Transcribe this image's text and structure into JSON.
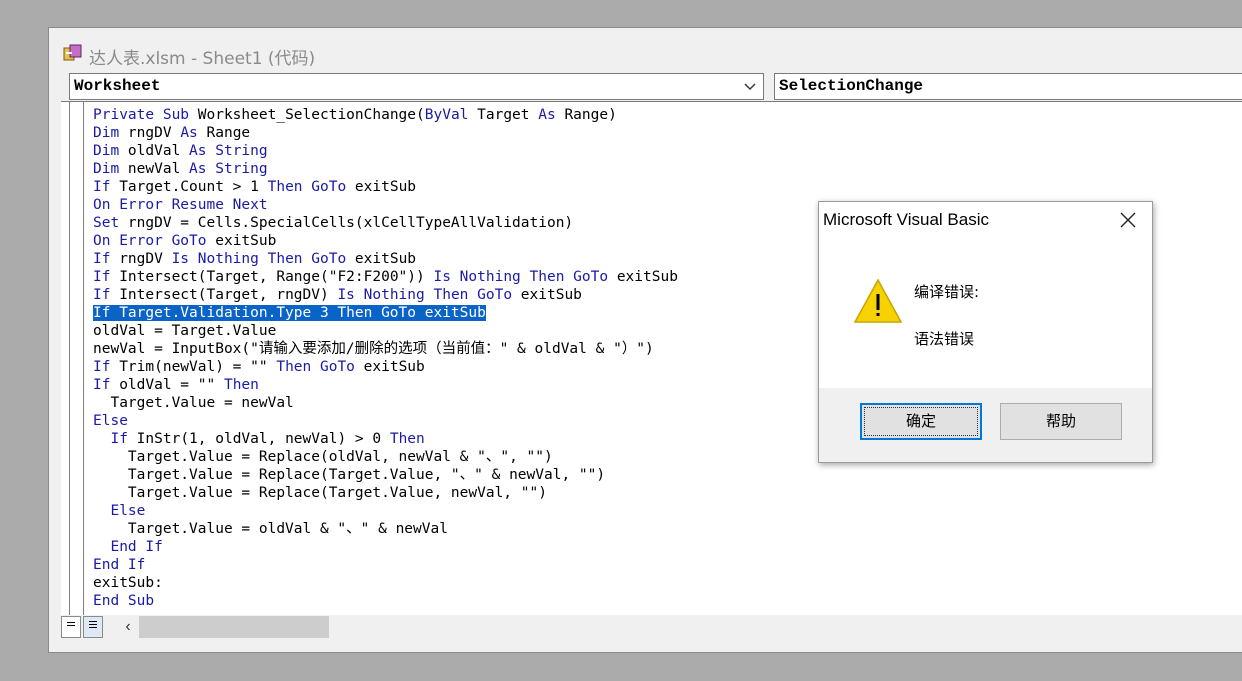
{
  "window": {
    "title": "达人表.xlsm - Sheet1 (代码)",
    "app_icon": "vba-project-icon"
  },
  "combos": {
    "object": "Worksheet",
    "procedure": "SelectionChange"
  },
  "code_lines": [
    [
      {
        "t": "Private Sub ",
        "k": true
      },
      {
        "t": "Worksheet_SelectionChange("
      },
      {
        "t": "ByVal",
        "k": true
      },
      {
        "t": " Target "
      },
      {
        "t": "As",
        "k": true
      },
      {
        "t": " Range)"
      }
    ],
    [
      {
        "t": "Dim",
        "k": true
      },
      {
        "t": " rngDV "
      },
      {
        "t": "As",
        "k": true
      },
      {
        "t": " Range"
      }
    ],
    [
      {
        "t": "Dim",
        "k": true
      },
      {
        "t": " oldVal "
      },
      {
        "t": "As String",
        "k": true
      }
    ],
    [
      {
        "t": "Dim",
        "k": true
      },
      {
        "t": " newVal "
      },
      {
        "t": "As String",
        "k": true
      }
    ],
    [
      {
        "t": "If",
        "k": true
      },
      {
        "t": " Target.Count > 1 "
      },
      {
        "t": "Then GoTo",
        "k": true
      },
      {
        "t": " exitSub"
      }
    ],
    [
      {
        "t": "On Error Resume Next",
        "k": true
      }
    ],
    [
      {
        "t": "Set",
        "k": true
      },
      {
        "t": " rngDV = Cells.SpecialCells(xlCellTypeAllValidation)"
      }
    ],
    [
      {
        "t": "On Error GoTo",
        "k": true
      },
      {
        "t": " exitSub"
      }
    ],
    [
      {
        "t": "If",
        "k": true
      },
      {
        "t": " rngDV "
      },
      {
        "t": "Is Nothing Then GoTo",
        "k": true
      },
      {
        "t": " exitSub"
      }
    ],
    [
      {
        "t": "If",
        "k": true
      },
      {
        "t": " Intersect(Target, Range(\"F2:F200\")) "
      },
      {
        "t": "Is Nothing Then GoTo",
        "k": true
      },
      {
        "t": " exitSub"
      }
    ],
    [
      {
        "t": "If",
        "k": true
      },
      {
        "t": " Intersect(Target, rngDV) "
      },
      {
        "t": "Is Nothing Then GoTo",
        "k": true
      },
      {
        "t": " exitSub"
      }
    ],
    [
      {
        "t": "If Target.Validation.Type 3 Then GoTo exitSub"
      }
    ],
    [
      {
        "t": "oldVal = Target.Value"
      }
    ],
    [
      {
        "t": "newVal = InputBox(\"请输入要添加/删除的选项（当前值：\" & oldVal & \"）\")"
      }
    ],
    [
      {
        "t": "If",
        "k": true
      },
      {
        "t": " Trim(newVal) = \"\" "
      },
      {
        "t": "Then GoTo",
        "k": true
      },
      {
        "t": " exitSub"
      }
    ],
    [
      {
        "t": "If",
        "k": true
      },
      {
        "t": " oldVal = \"\" "
      },
      {
        "t": "Then",
        "k": true
      }
    ],
    [
      {
        "t": "  Target.Value = newVal"
      }
    ],
    [
      {
        "t": "Else",
        "k": true
      }
    ],
    [
      {
        "t": "  "
      },
      {
        "t": "If",
        "k": true
      },
      {
        "t": " InStr(1, oldVal, newVal) > 0 "
      },
      {
        "t": "Then",
        "k": true
      }
    ],
    [
      {
        "t": "    Target.Value = Replace(oldVal, newVal & \"、\", \"\")"
      }
    ],
    [
      {
        "t": "    Target.Value = Replace(Target.Value, \"、\" & newVal, \"\")"
      }
    ],
    [
      {
        "t": "    Target.Value = Replace(Target.Value, newVal, \"\")"
      }
    ],
    [
      {
        "t": "  "
      },
      {
        "t": "Else",
        "k": true
      }
    ],
    [
      {
        "t": "    Target.Value = oldVal & \"、\" & newVal"
      }
    ],
    [
      {
        "t": "  "
      },
      {
        "t": "End If",
        "k": true
      }
    ],
    [
      {
        "t": "End If",
        "k": true
      }
    ],
    [
      {
        "t": "exitSub:"
      }
    ],
    [
      {
        "t": "End Sub",
        "k": true
      }
    ]
  ],
  "selected_line_index": 11,
  "dialog": {
    "title": "Microsoft Visual Basic",
    "message_title": "编译错误:",
    "message_body": "语法错误",
    "ok_label": "确定",
    "help_label": "帮助"
  },
  "colors": {
    "keyword": "#1a1aa6",
    "selection": "#0a64c8"
  }
}
